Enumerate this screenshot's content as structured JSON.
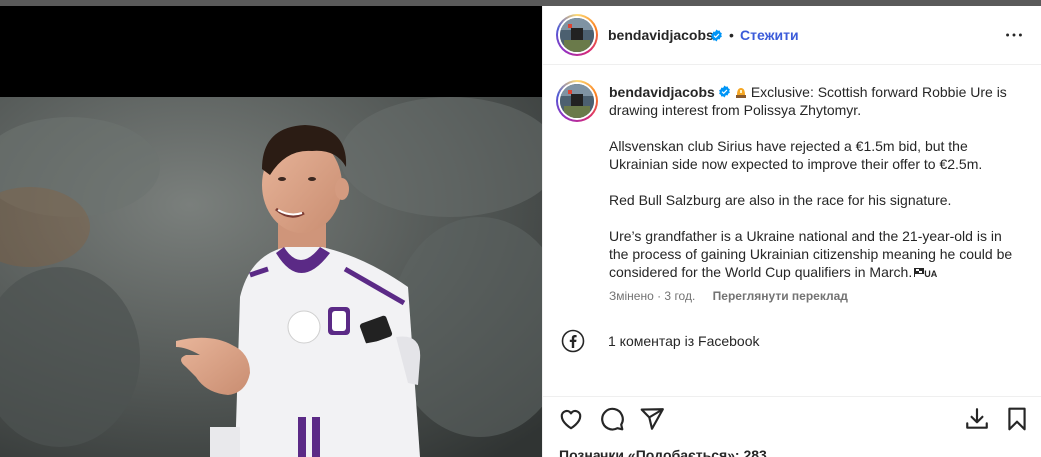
{
  "window": {
    "top_strip_color": "#5a5a5a"
  },
  "post": {
    "author": {
      "username": "bendavidjacobs",
      "verified": true,
      "avatar": "profile-photo",
      "follow_label": "Стежити",
      "separator": "•"
    },
    "caption": {
      "username": "bendavidjacobs",
      "emoji": "rotating-light-icon",
      "paragraphs": [
        [
          "Exclusive: Scottish forward Robbie Ure is",
          "drawing interest from Polissya Zhytomyr."
        ],
        [
          "Allsvenskan club Sirius have rejected a €1.5m bid, but the",
          "Ukrainian side now expected to improve their offer to €2.5m."
        ],
        [
          "Red Bull Salzburg are also in the race for his signature."
        ],
        [
          "Ure’s grandfather is a Ukraine national and the 21-year-old is in",
          "the process of gaining Ukrainian citizenship meaning he could be",
          "considered for the World Cup qualifiers in March."
        ]
      ],
      "flag_code": "UA"
    },
    "meta": {
      "edited": "Змінено · 3 год.",
      "see_translation": "Переглянути переклад"
    },
    "comment_link": {
      "icon": "facebook-icon",
      "text": "1 коментар із Facebook"
    },
    "actions": {
      "icons": [
        "heart-icon",
        "comment-icon",
        "share-icon",
        "save-icon",
        "bookmark-icon"
      ]
    },
    "likes_text": "Позначки «Подобається»: 283"
  },
  "colors": {
    "link_blue": "#3b5bd9",
    "verified_blue": "#0095f6",
    "text": "#262626",
    "secondary_text": "#737373",
    "jersey": "#f2f2f4",
    "jersey_trim": "#5b2a86"
  }
}
